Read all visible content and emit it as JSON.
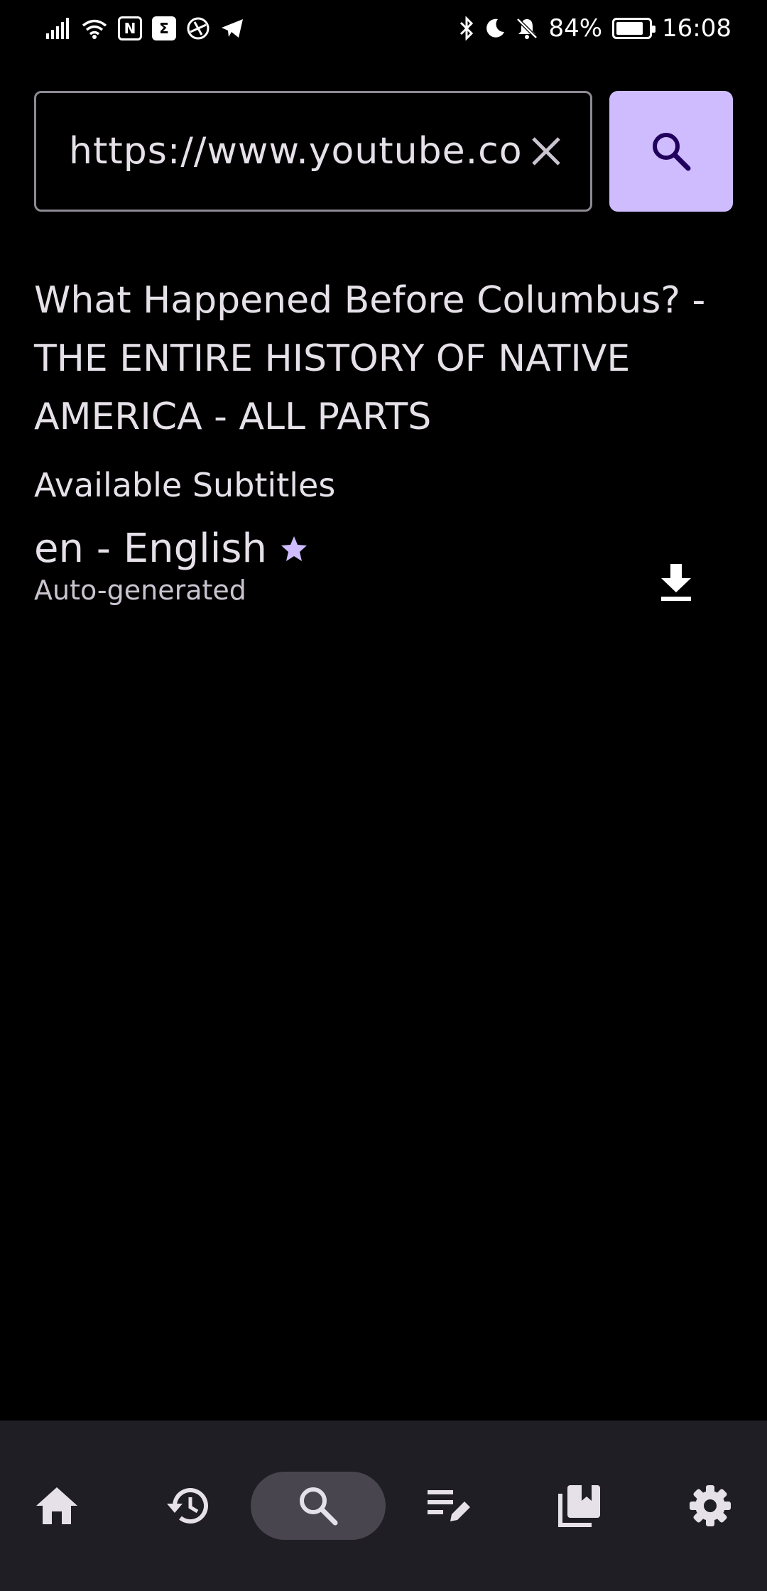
{
  "status_bar": {
    "battery_percent": "84%",
    "time": "16:08",
    "left_icons": [
      "signal-icon",
      "wifi-icon",
      "nfc-icon",
      "sigma-app-icon",
      "app-icon",
      "telegram-icon"
    ],
    "right_icons": [
      "bluetooth-icon",
      "moon-icon",
      "bell-off-icon",
      "battery-icon"
    ]
  },
  "search": {
    "url_value": "https://www.youtube.com/",
    "clear_icon": "close-icon",
    "search_icon": "search-icon",
    "accent_color": "#cfbcff"
  },
  "video": {
    "title": "What Happened Before Columbus? - THE ENTIRE HISTORY OF NATIVE AMERICA - ALL PARTS"
  },
  "subtitles": {
    "header": "Available Subtitles",
    "items": [
      {
        "language": "en - English",
        "type": "Auto-generated",
        "starred": true,
        "action_icon": "download-icon"
      }
    ]
  },
  "bottom_nav": {
    "items": [
      {
        "icon": "home-icon",
        "active": false
      },
      {
        "icon": "history-icon",
        "active": false
      },
      {
        "icon": "search-icon",
        "active": true
      },
      {
        "icon": "edit-list-icon",
        "active": false
      },
      {
        "icon": "library-icon",
        "active": false
      },
      {
        "icon": "settings-icon",
        "active": false
      }
    ]
  }
}
